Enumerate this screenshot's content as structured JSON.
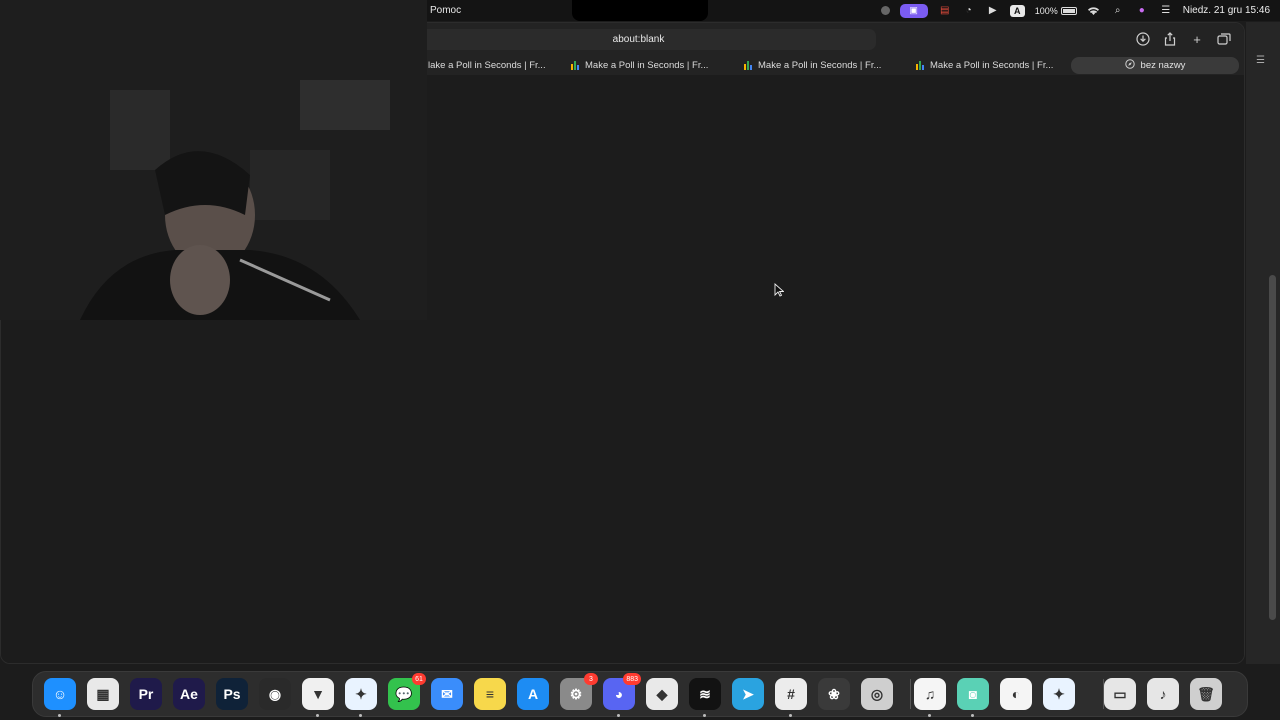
{
  "menubar": {
    "menu_item": "Pomoc",
    "battery": "100%",
    "datetime": "Niedz. 21 gru  15:46",
    "a_key": "A"
  },
  "browser": {
    "address": "about:blank",
    "tabs": [
      {
        "label": "lake a Poll in Seconds | Fr...",
        "favicon": "poll-icon"
      },
      {
        "label": "Make a Poll in Seconds | Fr...",
        "favicon": "poll-icon"
      },
      {
        "label": "Make a Poll in Seconds | Fr...",
        "favicon": "poll-icon"
      },
      {
        "label": "Make a Poll in Seconds | Fr...",
        "favicon": "poll-icon"
      }
    ],
    "active_tab": {
      "label": "bez nazwy",
      "icon": "compass-icon"
    }
  },
  "dock": {
    "apps": [
      {
        "name": "finder",
        "glyph": "☺",
        "bg": "#1e90ff",
        "running": true
      },
      {
        "name": "launchpad",
        "glyph": "▦",
        "bg": "#e9e9e9",
        "running": false
      },
      {
        "name": "premiere",
        "glyph": "Pr",
        "bg": "#1f1a4a",
        "running": false
      },
      {
        "name": "after-effects",
        "glyph": "Ae",
        "bg": "#1f1a4a",
        "running": false
      },
      {
        "name": "photoshop",
        "glyph": "Ps",
        "bg": "#0f2238",
        "running": false
      },
      {
        "name": "blender",
        "glyph": "◉",
        "bg": "#2a2a2a",
        "running": false
      },
      {
        "name": "brave",
        "glyph": "▼",
        "bg": "#f0f0f0",
        "running": true
      },
      {
        "name": "safari",
        "glyph": "✦",
        "bg": "#e9f3ff",
        "running": true
      },
      {
        "name": "messages",
        "glyph": "💬",
        "bg": "#33c24d",
        "running": false,
        "badge": "61"
      },
      {
        "name": "mail",
        "glyph": "✉",
        "bg": "#3a8dfb",
        "running": false
      },
      {
        "name": "notes",
        "glyph": "≡",
        "bg": "#f7d84b",
        "running": false
      },
      {
        "name": "app-store",
        "glyph": "A",
        "bg": "#1d8cf3",
        "running": false
      },
      {
        "name": "system-settings",
        "glyph": "⚙",
        "bg": "#8a8a8a",
        "running": false,
        "badge": "3"
      },
      {
        "name": "discord",
        "glyph": "◕",
        "bg": "#5865f2",
        "running": true,
        "badge": "883"
      },
      {
        "name": "roblox",
        "glyph": "◆",
        "bg": "#e9e9e9",
        "running": false
      },
      {
        "name": "spotify",
        "glyph": "≋",
        "bg": "#121212",
        "running": true
      },
      {
        "name": "telegram",
        "glyph": "➤",
        "bg": "#2aa3e0",
        "running": false
      },
      {
        "name": "slack",
        "glyph": "#",
        "bg": "#ececec",
        "running": true
      },
      {
        "name": "fl-studio",
        "glyph": "❀",
        "bg": "#3a3a3a",
        "running": false
      },
      {
        "name": "compressor",
        "glyph": "◎",
        "bg": "#cfcfcf",
        "running": false
      },
      {
        "name": "music",
        "glyph": "♫",
        "bg": "#f5f5f5",
        "running": true
      },
      {
        "name": "chatgpt-app",
        "glyph": "◙",
        "bg": "#5ad1b5",
        "running": true
      },
      {
        "name": "quick-share",
        "glyph": "◐",
        "bg": "#f5f5f5",
        "running": false
      },
      {
        "name": "safari-2",
        "glyph": "✦",
        "bg": "#e9f3ff",
        "running": false
      },
      {
        "name": "documents",
        "glyph": "▭",
        "bg": "#e6e6e6",
        "running": false
      },
      {
        "name": "music-file",
        "glyph": "♪",
        "bg": "#e6e6e6",
        "running": false
      },
      {
        "name": "trash",
        "glyph": "🗑",
        "bg": "#cfcfcf",
        "running": false
      }
    ]
  }
}
